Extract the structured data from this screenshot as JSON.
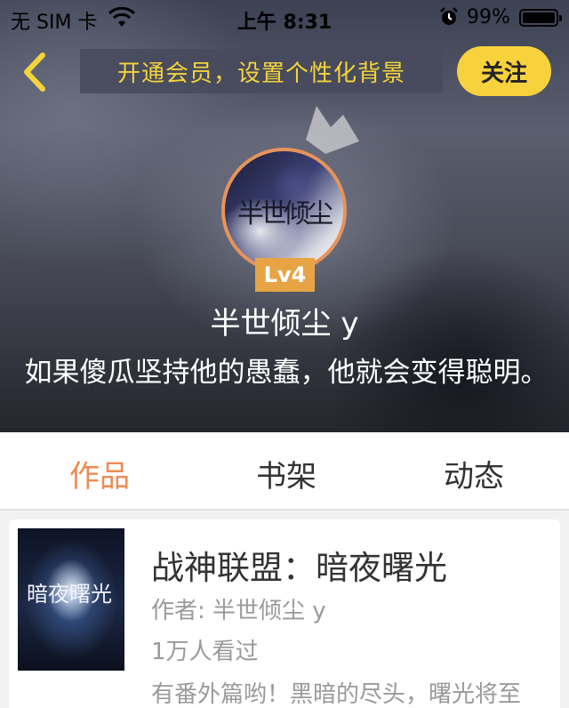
{
  "status_bar": {
    "carrier": "无 SIM 卡",
    "time": "上午 8:31",
    "battery": "99%",
    "battery_level": 0.99,
    "icons": [
      "wifi-icon",
      "alarm-icon",
      "battery-icon"
    ]
  },
  "header": {
    "back_icon": "chevron-left-icon",
    "vip_banner": "开通会员，设置个性化背景",
    "follow_label": "关注"
  },
  "profile": {
    "avatar_text": "半世倾尘",
    "level": "Lv4",
    "username": "半世倾尘 y",
    "bio": "如果傻瓜坚持他的愚蠢，他就会变得聪明。"
  },
  "tabs": [
    {
      "label": "作品",
      "active": true
    },
    {
      "label": "书架",
      "active": false
    },
    {
      "label": "动态",
      "active": false
    }
  ],
  "works": [
    {
      "cover_text": "暗夜曙光",
      "title": "战神联盟：暗夜曙光",
      "author": "作者: 半世倾尘 y",
      "readers": "1万人看过",
      "description": "有番外篇哟！黑暗的尽头，曙光将至"
    }
  ],
  "colors": {
    "accent": "#ef8a52",
    "vip_text": "#f5d33a",
    "follow_bg": "#f7d23c",
    "level_bg": "#e7a445"
  }
}
